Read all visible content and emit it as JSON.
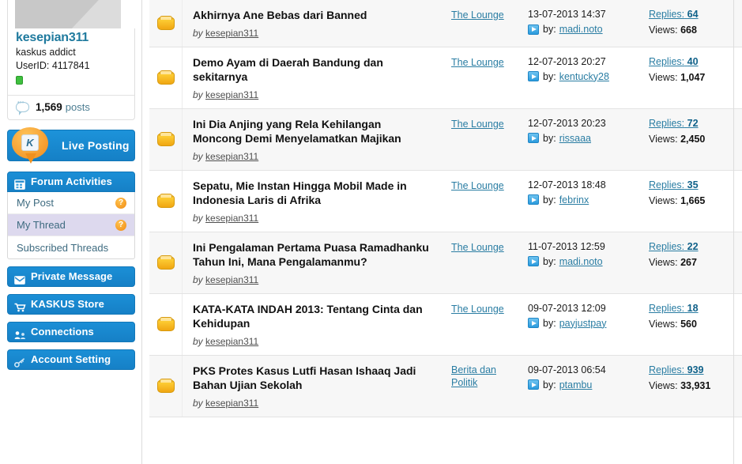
{
  "sidebar": {
    "profile": {
      "username": "kesepian311",
      "usertitle": "kaskus addict",
      "userid_label": "UserID: 4117841",
      "posts_count": "1,569",
      "posts_label": "posts"
    },
    "live_posting_label": "Live Posting",
    "forum_activities": {
      "label": "Forum Activities",
      "items": [
        {
          "label": "My Post",
          "badge": "?",
          "active": false
        },
        {
          "label": "My Thread",
          "badge": "?",
          "active": true
        },
        {
          "label": "Subscribed Threads",
          "badge": "",
          "active": false
        }
      ]
    },
    "buttons": [
      {
        "label": "Private Message",
        "icon": "envelope-icon"
      },
      {
        "label": "KASKUS Store",
        "icon": "cart-icon"
      },
      {
        "label": "Connections",
        "icon": "connections-icon"
      },
      {
        "label": "Account Setting",
        "icon": "key-icon"
      }
    ]
  },
  "threads": {
    "by_prefix": "by",
    "replies_prefix": "Replies:",
    "views_prefix": "Views:",
    "lastpost_prefix": "by:",
    "rows": [
      {
        "title": "Akhirnya Ane Bebas dari Banned",
        "author": "kesepian311",
        "forum": "The Lounge",
        "date": "13-07-2013 14:37",
        "lastposter": "madi.noto",
        "replies": "64",
        "views": "668"
      },
      {
        "title": "Demo Ayam di Daerah Bandung dan sekitarnya",
        "author": "kesepian311",
        "forum": "The Lounge",
        "date": "12-07-2013 20:27",
        "lastposter": "kentucky28",
        "replies": "40",
        "views": "1,047"
      },
      {
        "title": "Ini Dia Anjing yang Rela Kehilangan Moncong Demi Menyelamatkan Majikan",
        "author": "kesepian311",
        "forum": "The Lounge",
        "date": "12-07-2013 20:23",
        "lastposter": "rissaaa",
        "replies": "72",
        "views": "2,450"
      },
      {
        "title": "Sepatu, Mie Instan Hingga Mobil Made in Indonesia Laris di Afrika",
        "author": "kesepian311",
        "forum": "The Lounge",
        "date": "12-07-2013 18:48",
        "lastposter": "febrinx",
        "replies": "35",
        "views": "1,665"
      },
      {
        "title": "Ini Pengalaman Pertama Puasa Ramadhanku Tahun Ini, Mana Pengalamanmu?",
        "author": "kesepian311",
        "forum": "The Lounge",
        "date": "11-07-2013 12:59",
        "lastposter": "madi.noto",
        "replies": "22",
        "views": "267"
      },
      {
        "title": "KATA-KATA INDAH 2013: Tentang Cinta dan Kehidupan",
        "author": "kesepian311",
        "forum": "The Lounge",
        "date": "09-07-2013 12:09",
        "lastposter": "payjustpay",
        "replies": "18",
        "views": "560"
      },
      {
        "title": "PKS Protes Kasus Lutfi Hasan Ishaaq Jadi Bahan Ujian Sekolah",
        "author": "kesepian311",
        "forum": "Berita dan Politik",
        "date": "09-07-2013 06:54",
        "lastposter": "ptambu",
        "replies": "939",
        "views": "33,931"
      }
    ]
  },
  "colors": {
    "accent_blue": "#1680c6",
    "link_blue": "#2a7da3",
    "username_blue": "#1f7a9e",
    "active_row": "#ddd9ee",
    "folder_yellow": "#f0a612",
    "badge_orange": "#f08a13",
    "online_green": "#3fbf3f"
  }
}
